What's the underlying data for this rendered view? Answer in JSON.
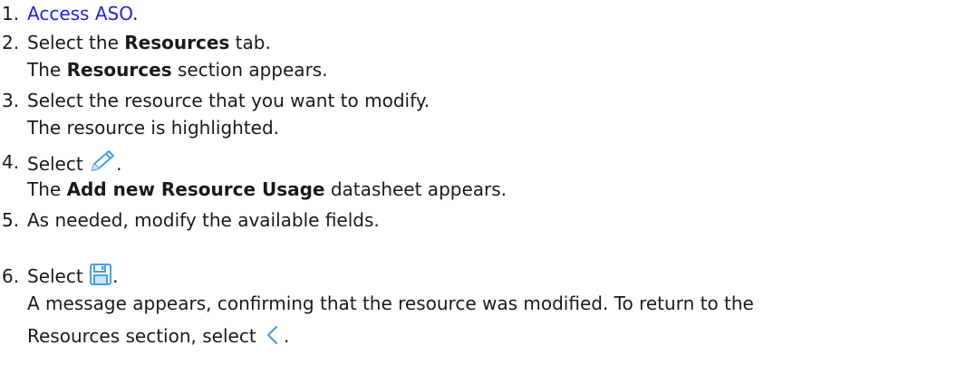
{
  "steps": [
    {
      "number": "1.",
      "link_text": "Access ASO",
      "after_link": "."
    },
    {
      "number": "2.",
      "before": "Select the ",
      "bold": "Resources",
      "after": " tab.",
      "result_bold": "Resources",
      "result_before": "The ",
      "result_after": " section appears."
    },
    {
      "number": "3.",
      "text": "Select the resource that you want to modify.",
      "result": "The resource is highlighted."
    },
    {
      "number": "4.",
      "before": "Select ",
      "icon": "pencil-edit-icon",
      "after": ".",
      "result_before": "The ",
      "result_bold": "Add new Resource Usage",
      "result_after": " datasheet appears."
    },
    {
      "number": "5.",
      "text": "As needed, modify the available fields."
    },
    {
      "number": "6.",
      "before": "Select ",
      "icon": "save-disk-icon",
      "after": ".",
      "result_line1": "A message appears, confirming that the resource was modified. To return to the",
      "result_line2_before": "Resources section, select ",
      "result_line2_icon": "chevron-left-icon",
      "result_line2_after": "."
    }
  ],
  "colors": {
    "link": "#2323e0",
    "icon": "#4a9ee6",
    "text": "#1a1a1a"
  }
}
